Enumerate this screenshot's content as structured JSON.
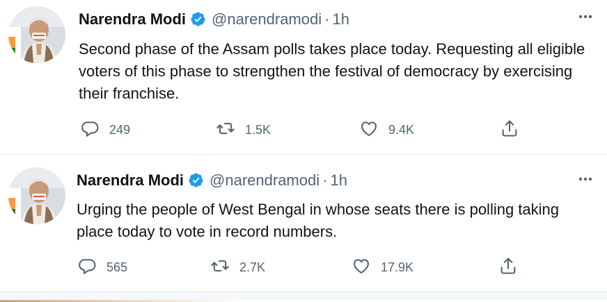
{
  "tweets": [
    {
      "name": "Narendra Modi",
      "handle": "@narendramodi",
      "separator": "·",
      "time": "1h",
      "text": "Second phase of the Assam polls takes place today. Requesting all eligible voters of this phase to strengthen the festival of democracy by exercising their franchise.",
      "replies": "249",
      "retweets": "1.5K",
      "likes": "9.4K"
    },
    {
      "name": "Narendra Modi",
      "handle": "@narendramodi",
      "separator": "·",
      "time": "1h",
      "text": "Urging the people of West Bengal in whose seats there is polling taking place today to vote in record numbers.",
      "replies": "565",
      "retweets": "2.7K",
      "likes": "17.9K"
    }
  ],
  "icons": {
    "verified": "verified-badge-icon",
    "more": "more-horizontal-icon",
    "reply": "reply-icon",
    "retweet": "retweet-icon",
    "like": "like-icon",
    "share": "share-icon"
  },
  "colors": {
    "accent": "#1d9bf0",
    "text": "#0f1419",
    "secondary": "#536471",
    "divider": "#e6ecf0"
  }
}
